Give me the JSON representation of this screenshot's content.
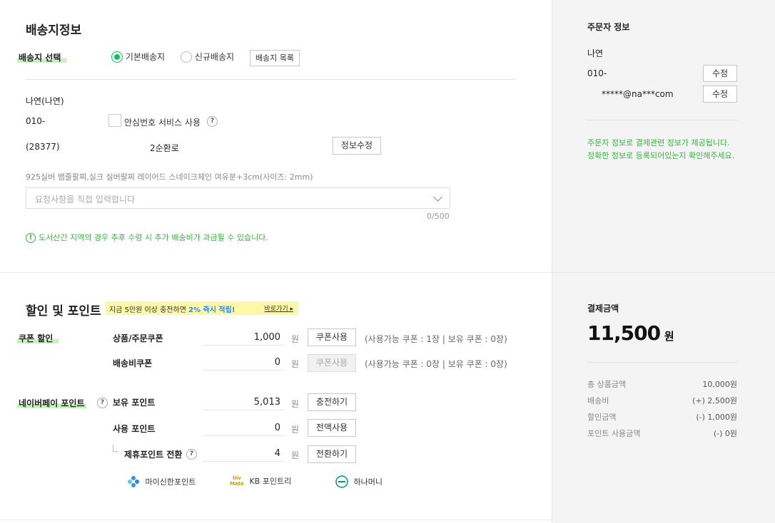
{
  "shipping": {
    "title": "배송지정보",
    "select_label": "배송지 선택",
    "radio_default": "기본배송지",
    "radio_new": "신규배송지",
    "list_button": "배송지 목록",
    "name": "나연(나연)",
    "phone": "010-",
    "safe_number_label": "안심번호 서비스 사용",
    "postcode": "(28377)",
    "address_fragment": "2순환로",
    "edit_button": "정보수정",
    "product_note": "925실버 뱀줄팔찌,실크 실버팔찌 레이어드 스네이크체인 여유분+3cm(사이즈: 2mm)",
    "request_placeholder": "요청사항을 직접 입력합니다",
    "char_count": "0/500",
    "notice": "도서산간 지역의 경우 추후 수령 시 추가 배송비가 과금될 수 있습니다."
  },
  "discount": {
    "title": "할인 및 포인트",
    "promo_text_1": "지금 5만원 이상 충전하면 ",
    "promo_pct": "2% 즉시 적립!",
    "promo_link": "바로가기",
    "coupon_label": "쿠폰 할인",
    "product_coupon_label": "상품/주문쿠폰",
    "product_coupon_value": "1,000",
    "shipping_coupon_label": "배송비쿠폰",
    "shipping_coupon_value": "0",
    "won": "원",
    "coupon_use_button": "쿠폰사용",
    "product_coupon_info": "(사용가능 쿠폰 : 1장 | 보유 쿠폰 : 0장)",
    "shipping_coupon_info": "(사용가능 쿠폰 : 0장 | 보유 쿠폰 : 0장)",
    "npay_label": "네이버페이 포인트",
    "held_points_label": "보유 포인트",
    "held_points_value": "5,013",
    "charge_button": "충전하기",
    "use_points_label": "사용 포인트",
    "use_points_value": "0",
    "use_all_button": "전액사용",
    "partner_points_label": "제휴포인트 전환",
    "partner_points_value": "4",
    "convert_button": "전환하기",
    "partners": [
      "마이신한포인트",
      "KB 포인트리",
      "하나머니"
    ]
  },
  "orderer": {
    "title": "주문자 정보",
    "name": "나연",
    "phone": "010-",
    "email": "*****@na***com",
    "edit_button": "수정",
    "note_1": "주문자 정보로 결제관련 정보가 제공됩니다.",
    "note_2": "정확한 정보로 등록되어있는지 확인해주세요."
  },
  "payment": {
    "title": "결제금액",
    "total": "11,500",
    "won": "원",
    "rows": [
      {
        "label": "총 상품금액",
        "value": "10,000원"
      },
      {
        "label": "배송비",
        "value": "(+) 2,500원"
      },
      {
        "label": "할인금액",
        "value": "(-) 1,000원"
      },
      {
        "label": "포인트 사용금액",
        "value": "(-) 0원"
      }
    ]
  }
}
